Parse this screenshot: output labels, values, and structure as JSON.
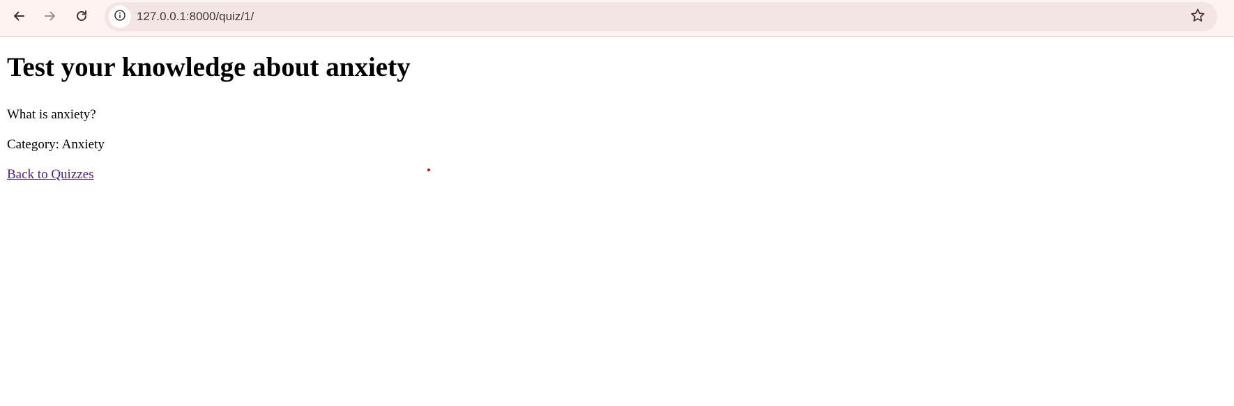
{
  "browser": {
    "url": "127.0.0.1:8000/quiz/1/",
    "icons": {
      "back": "back-arrow-icon",
      "forward": "forward-arrow-icon",
      "reload": "reload-icon",
      "site_info": "info-icon",
      "bookmark": "star-icon"
    },
    "colors": {
      "toolbar_bg": "#fdf3f0",
      "omnibox_bg": "#f3e5e3",
      "icon": "#3c3535"
    }
  },
  "page": {
    "title": "Test your knowledge about anxiety",
    "question": "What is anxiety?",
    "category": "Category: Anxiety",
    "back_link": "Back to Quizzes",
    "colors": {
      "text": "#000000",
      "visited_link": "#551a8b"
    }
  }
}
